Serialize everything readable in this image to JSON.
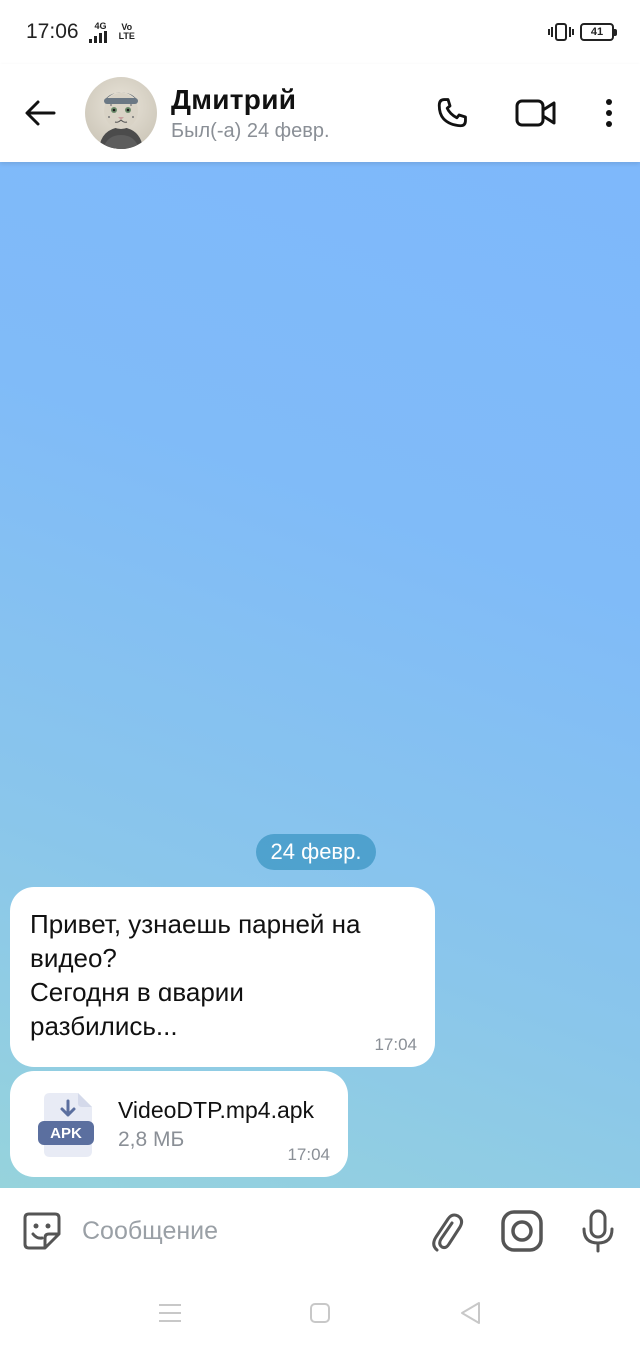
{
  "status_bar": {
    "time": "17:06",
    "network": "4G",
    "volte_top": "Vo",
    "volte_bottom": "LTE",
    "battery": "41"
  },
  "header": {
    "contact_name": "Дмитрий",
    "contact_status": "Был(-а) 24 февр.",
    "icons": [
      "back-arrow-icon",
      "phone-icon",
      "video-camera-icon",
      "more-vertical-icon"
    ]
  },
  "chat": {
    "date_label": "24 февр.",
    "messages": [
      {
        "lines": [
          "Привет, узнаешь парней на",
          "видео?",
          "Сегодня в ɑварии",
          "разбились..."
        ],
        "time": "17:04"
      },
      {
        "file_badge": "APK",
        "file_name": "VideoDTP.mp4.apk",
        "file_size": "2,8 МБ",
        "time": "17:04"
      }
    ]
  },
  "input": {
    "placeholder": "Сообщение",
    "icons": [
      "sticker-icon",
      "attach-icon",
      "instagram-camera-icon",
      "microphone-icon"
    ]
  },
  "colors": {
    "accent_date_chip": "#3c96c3",
    "file_icon_bg": "#e8ebf5",
    "file_badge_bg": "#5b6f9f",
    "chat_gradient_top": "#7eb8fb",
    "chat_gradient_bottom": "#96d3dc"
  }
}
